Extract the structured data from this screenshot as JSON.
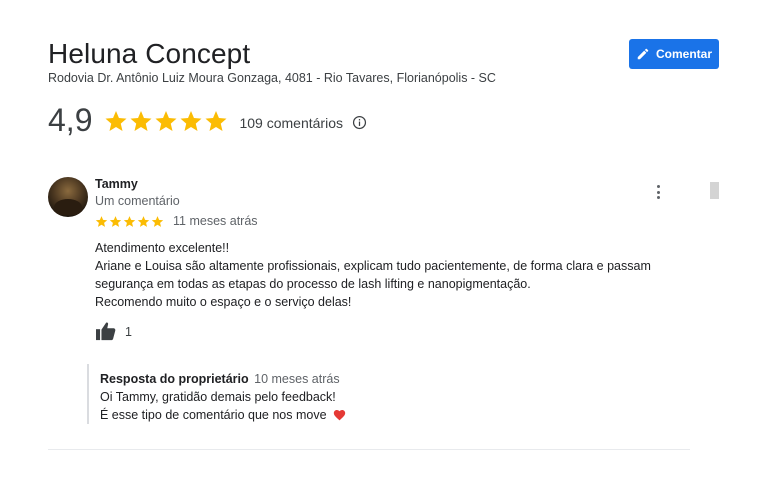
{
  "business": {
    "name": "Heluna Concept",
    "address": "Rodovia Dr. Antônio Luiz Moura Gonzaga, 4081 - Rio Tavares, Florianópolis - SC"
  },
  "actions": {
    "comment_button_label": "Comentar",
    "comment_icon": "pencil-icon"
  },
  "rating": {
    "value": "4,9",
    "stars": 5,
    "review_count_label": "109 comentários",
    "info_icon": "info-icon"
  },
  "review": {
    "reviewer_name": "Tammy",
    "reviewer_meta": "Um comentário",
    "stars": 5,
    "date": "11 meses atrás",
    "text_lines": [
      "Atendimento excelente!!",
      "Ariane e Louisa são altamente profissionais, explicam tudo pacientemente, de forma clara e passam",
      "segurança em todas as etapas do processo de lash lifting e nanopigmentação.",
      "Recomendo muito o espaço e o serviço delas!"
    ],
    "like_count": "1",
    "like_icon": "thumbs-up-icon",
    "more_icon": "more-vert-icon"
  },
  "owner_reply": {
    "label": "Resposta do proprietário",
    "date": "10 meses atrás",
    "lines": [
      "Oi Tammy, gratidão demais pelo feedback!",
      "É esse tipo de comentário que nos move"
    ],
    "emoji_icon": "heart-icon"
  },
  "colors": {
    "accent": "#1a73e8",
    "star": "#fbbc04",
    "heart": "#e53935"
  }
}
